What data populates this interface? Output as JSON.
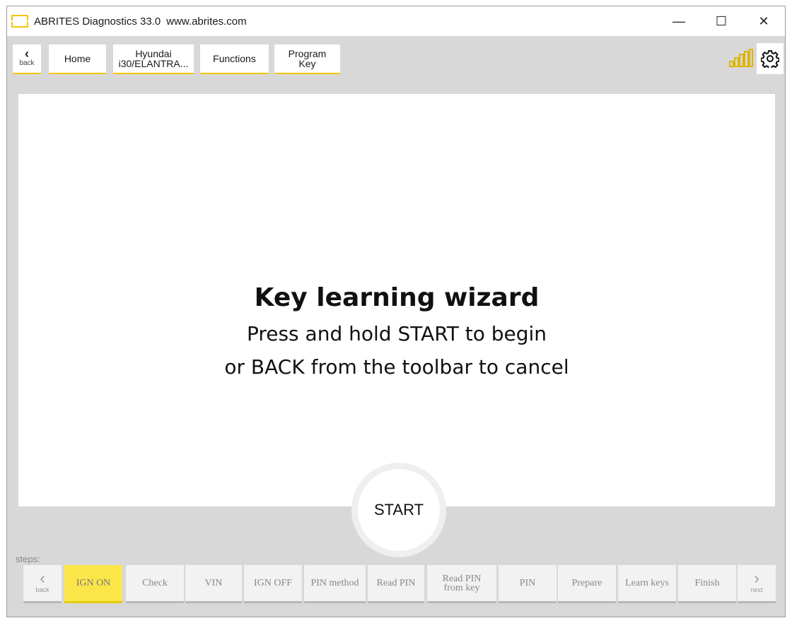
{
  "window": {
    "title": "ABRITES Diagnostics 33.0",
    "url": "www.abrites.com",
    "minimize": "—",
    "maximize": "☐",
    "close": "✕"
  },
  "toolbar": {
    "back_label": "back",
    "home_label": "Home",
    "vehicle_line1": "Hyundai",
    "vehicle_line2": "i30/ELANTRA...",
    "functions_label": "Functions",
    "program_line1": "Program",
    "program_line2": "Key"
  },
  "main": {
    "headline": "Key learning wizard",
    "line1": "Press and hold START to begin",
    "line2": "or BACK from the toolbar to cancel",
    "start_label": "START"
  },
  "steps": {
    "label": "steps:",
    "back_label": "back",
    "next_label": "next",
    "items": [
      {
        "line1": "IGN ON",
        "line2": "",
        "active": true
      },
      {
        "line1": "Check",
        "line2": "",
        "active": false
      },
      {
        "line1": "VIN",
        "line2": "",
        "active": false
      },
      {
        "line1": "IGN OFF",
        "line2": "",
        "active": false
      },
      {
        "line1": "PIN method",
        "line2": "",
        "active": false
      },
      {
        "line1": "Read PIN",
        "line2": "",
        "active": false
      },
      {
        "line1": "Read PIN",
        "line2": "from key",
        "active": false
      },
      {
        "line1": "PIN",
        "line2": "",
        "active": false
      },
      {
        "line1": "Prepare",
        "line2": "",
        "active": false
      },
      {
        "line1": "Learn keys",
        "line2": "",
        "active": false
      },
      {
        "line1": "Finish",
        "line2": "",
        "active": false
      }
    ]
  },
  "colors": {
    "accent": "#f5c400",
    "active_step": "#fbe64a",
    "chrome": "#d8d8d8"
  },
  "icons": {
    "logo": "abrites-logo-icon",
    "signal": "signal-strength-icon",
    "settings": "gear-icon"
  }
}
